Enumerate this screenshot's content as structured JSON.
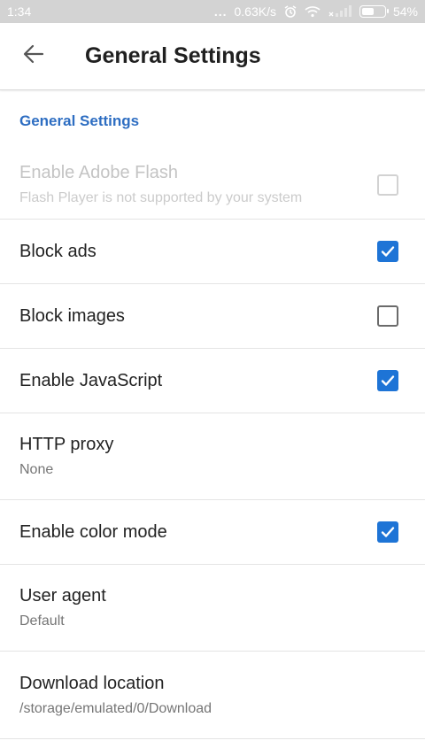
{
  "status_bar": {
    "time": "1:34",
    "dots": "...",
    "speed": "0.63K/s",
    "battery": "54%",
    "battery_level": 0.54
  },
  "app_bar": {
    "back_icon": "arrow-left-icon",
    "title": "General Settings"
  },
  "section": {
    "header": "General Settings"
  },
  "items": [
    {
      "label": "Enable Adobe Flash",
      "summary": "Flash Player is not supported by your system",
      "checked": false,
      "enabled": false
    },
    {
      "label": "Block ads",
      "checked": true,
      "enabled": true
    },
    {
      "label": "Block images",
      "checked": false,
      "enabled": true
    },
    {
      "label": "Enable JavaScript",
      "checked": true,
      "enabled": true
    },
    {
      "label": "HTTP proxy",
      "summary": "None"
    },
    {
      "label": "Enable color mode",
      "checked": true,
      "enabled": true
    },
    {
      "label": "User agent",
      "summary": "Default"
    },
    {
      "label": "Download location",
      "summary": "/storage/emulated/0/Download"
    }
  ],
  "colors": {
    "accent": "#1e74d6",
    "section_header": "#2e6ec2",
    "status_bar": "#d3d3d3"
  }
}
